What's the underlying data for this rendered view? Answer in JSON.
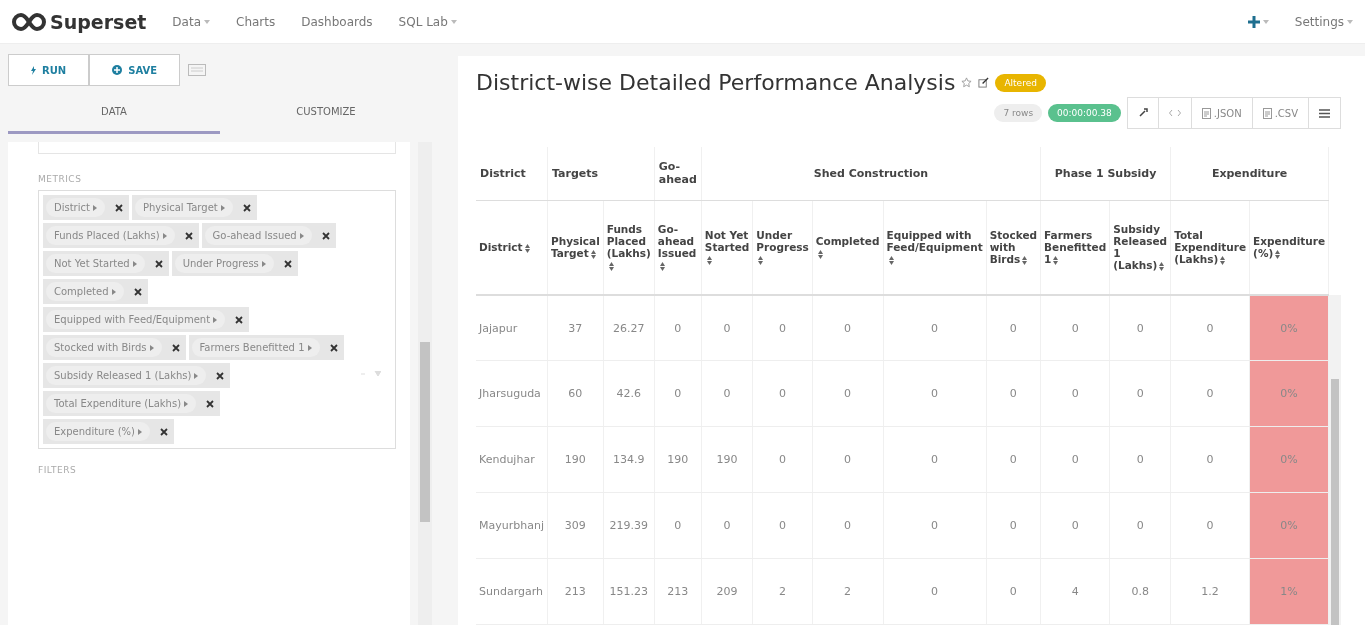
{
  "navbar": {
    "brand": "Superset",
    "menu": [
      {
        "label": "Data",
        "dropdown": true
      },
      {
        "label": "Charts",
        "dropdown": false
      },
      {
        "label": "Dashboards",
        "dropdown": false
      },
      {
        "label": "SQL Lab",
        "dropdown": true
      }
    ],
    "settings": "Settings"
  },
  "sidebar": {
    "run": "RUN",
    "save": "SAVE",
    "tabs": [
      {
        "label": "DATA",
        "selected": true
      },
      {
        "label": "CUSTOMIZE",
        "selected": false
      }
    ],
    "metrics_label": "METRICS",
    "metrics": [
      "District",
      "Physical Target",
      "Funds Placed (Lakhs)",
      "Go-ahead Issued",
      "Not Yet Started",
      "Under Progress",
      "Completed",
      "Equipped with Feed/Equipment",
      "Stocked with Birds",
      "Farmers Benefitted 1",
      "Subsidy Released 1 (Lakhs)",
      "Total Expenditure (Lakhs)",
      "Expenditure (%)"
    ],
    "filters_label": "FILTERS"
  },
  "chart": {
    "title": "District-wise Detailed Performance Analysis",
    "status": "Altered",
    "row_count": "7 rows",
    "timer": "00:00:00.38",
    "actions": [
      {
        "kind": "link"
      },
      {
        "kind": "code"
      },
      {
        "kind": "file",
        "label": ".JSON"
      },
      {
        "kind": "file",
        "label": ".CSV"
      },
      {
        "kind": "menu"
      }
    ],
    "groups": [
      {
        "label": "District",
        "columns": [
          "District"
        ]
      },
      {
        "label": "Targets",
        "columns": [
          "Physical Target",
          "Funds Placed (Lakhs)"
        ]
      },
      {
        "label": "Go-ahead",
        "columns": [
          "Go-ahead Issued"
        ]
      },
      {
        "label": "Shed Construction",
        "columns": [
          "Not Yet Started",
          "Under Progress",
          "Completed",
          "Equipped with Feed/Equipment",
          "Stocked with Birds"
        ]
      },
      {
        "label": "Phase 1 Subsidy",
        "columns": [
          "Farmers Benefitted 1",
          "Subsidy Released 1 (Lakhs)"
        ]
      },
      {
        "label": "Expenditure",
        "columns": [
          "Total Expenditure (Lakhs)",
          "Expenditure (%)"
        ]
      }
    ],
    "rows": [
      {
        "cells": [
          "Jajapur",
          "37",
          "26.27",
          "0",
          "0",
          "0",
          "0",
          "0",
          "0",
          "0",
          "0",
          "0",
          "0%"
        ],
        "flagged": true
      },
      {
        "cells": [
          "Jharsuguda",
          "60",
          "42.6",
          "0",
          "0",
          "0",
          "0",
          "0",
          "0",
          "0",
          "0",
          "0",
          "0%"
        ],
        "flagged": true
      },
      {
        "cells": [
          "Kendujhar",
          "190",
          "134.9",
          "190",
          "190",
          "0",
          "0",
          "0",
          "0",
          "0",
          "0",
          "0",
          "0%"
        ],
        "flagged": true
      },
      {
        "cells": [
          "Mayurbhanj",
          "309",
          "219.39",
          "0",
          "0",
          "0",
          "0",
          "0",
          "0",
          "0",
          "0",
          "0",
          "0%"
        ],
        "flagged": true
      },
      {
        "cells": [
          "Sundargarh",
          "213",
          "151.23",
          "213",
          "209",
          "2",
          "2",
          "0",
          "0",
          "4",
          "0.8",
          "1.2",
          "1%"
        ],
        "flagged": true
      }
    ]
  }
}
